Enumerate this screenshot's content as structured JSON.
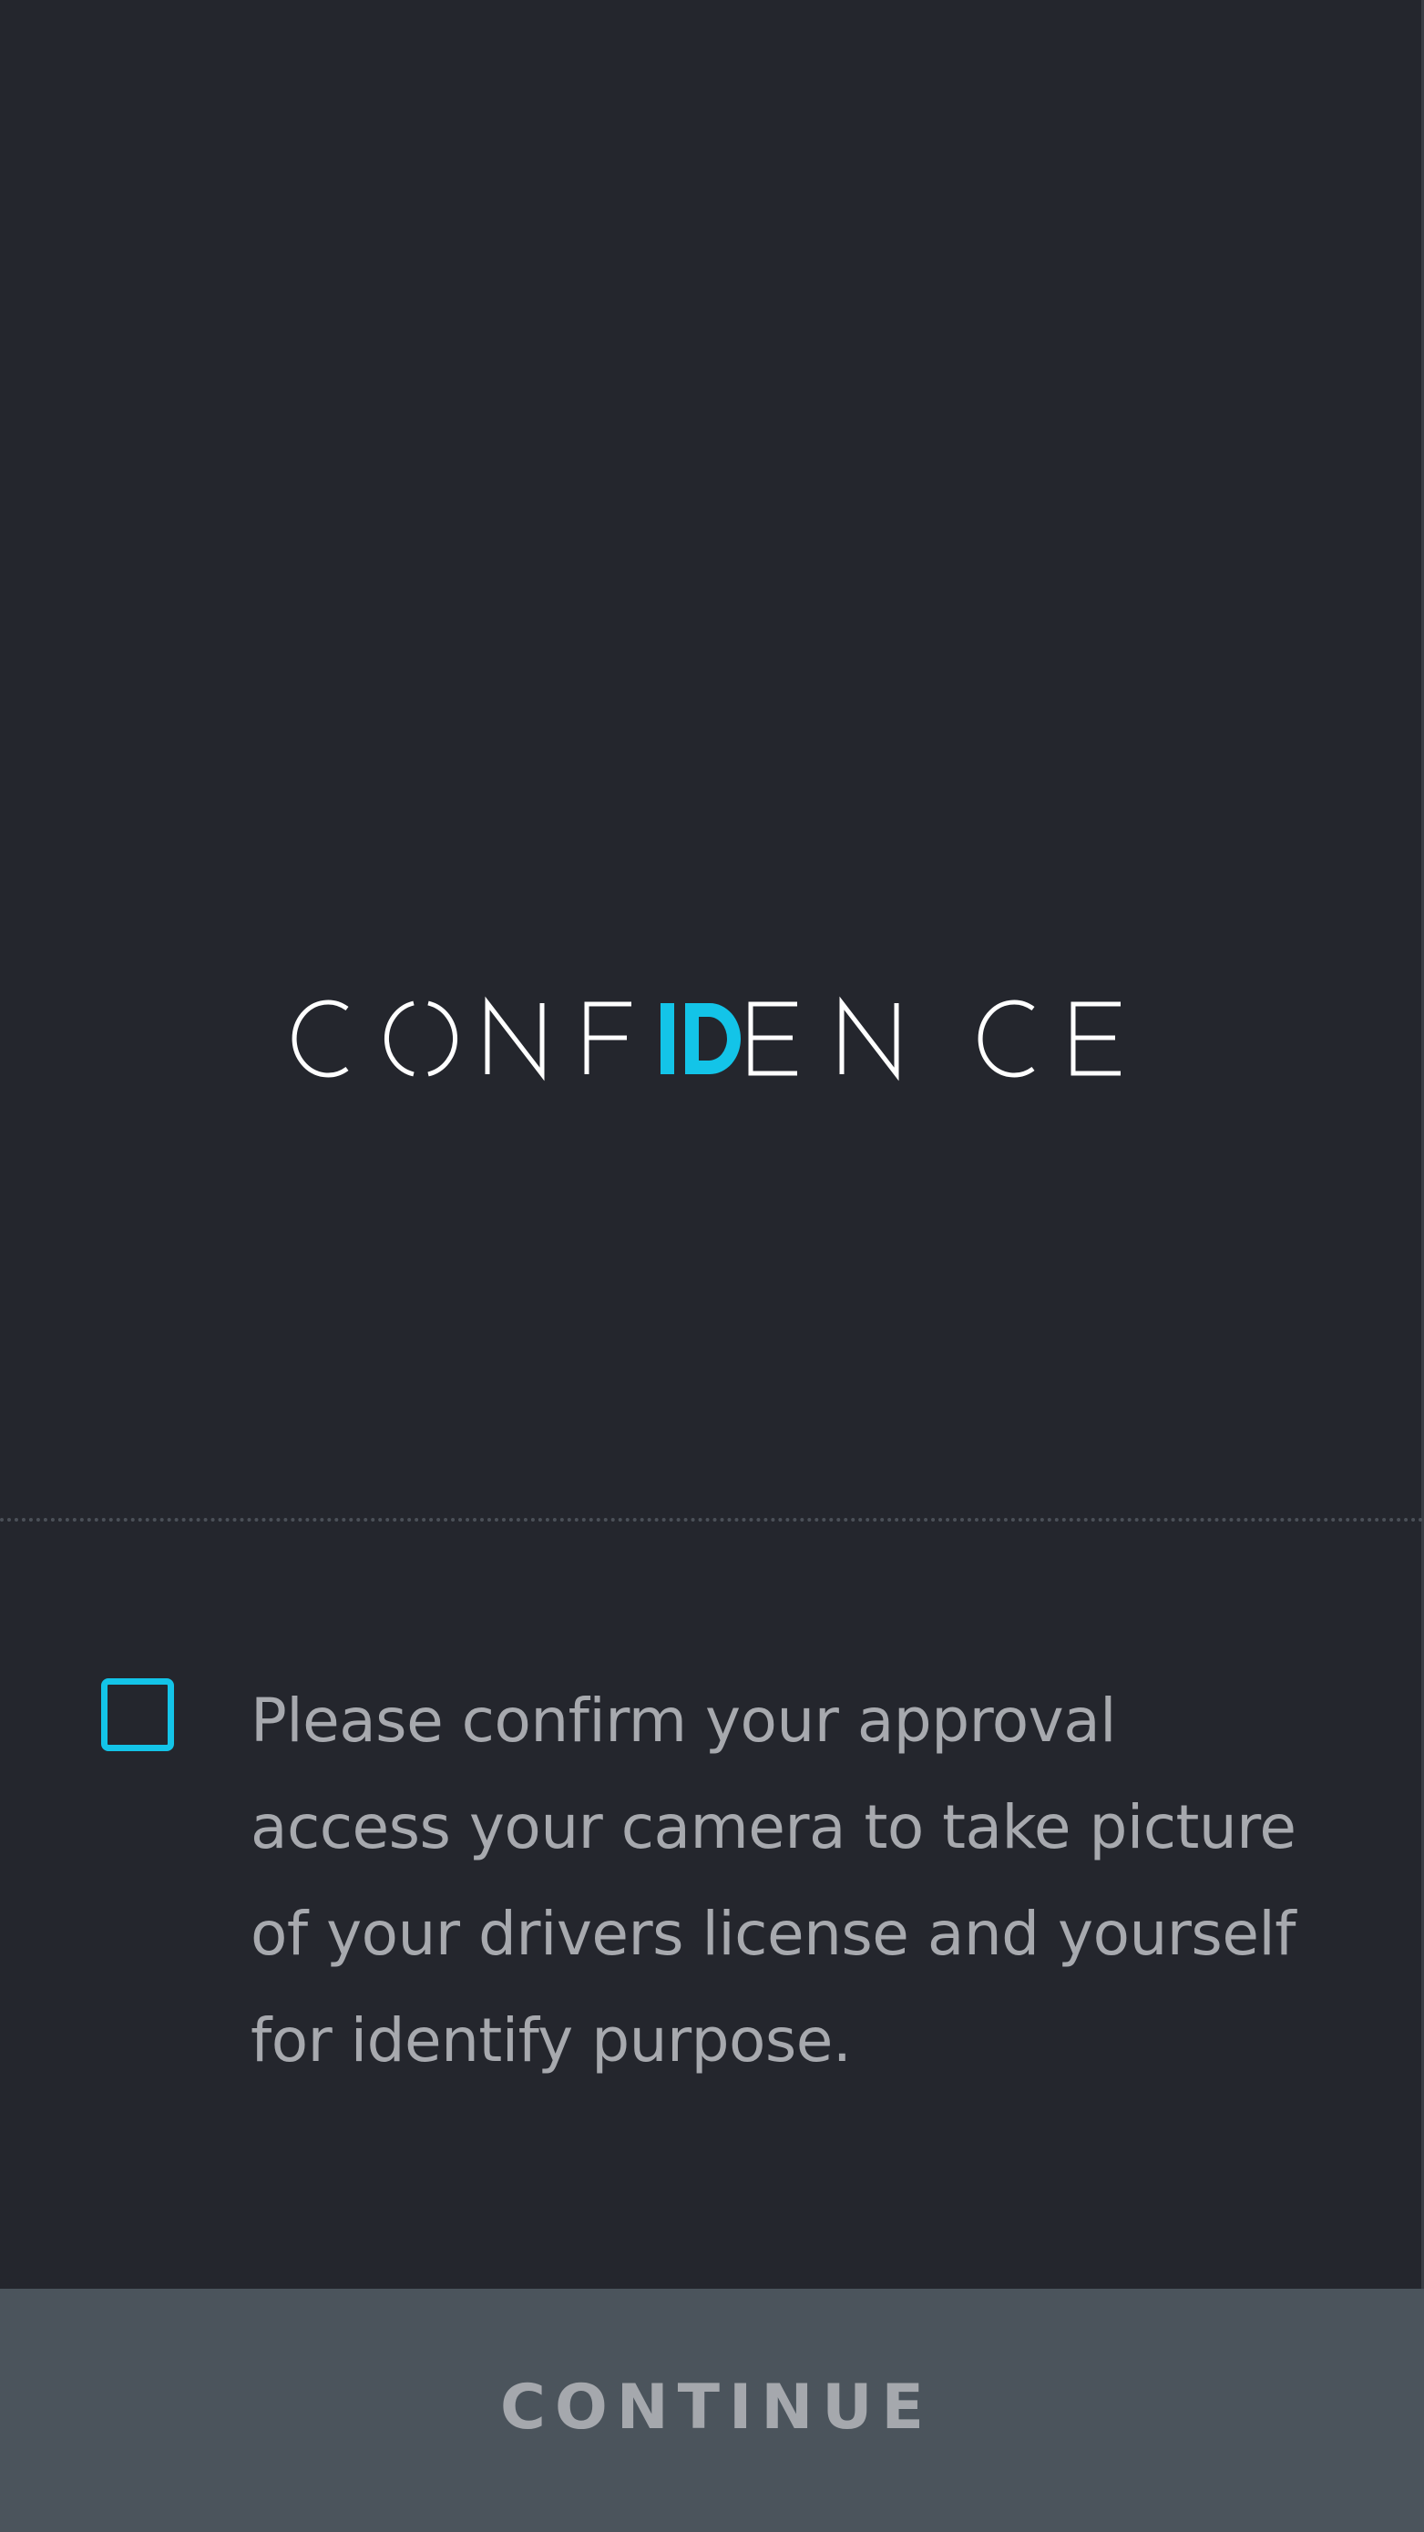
{
  "brand": {
    "logo_text": "CONFIDENCE",
    "logo_highlight": "ID",
    "logo_color": "#ffffff",
    "highlight_color": "#13c4e8"
  },
  "consent": {
    "checked": false,
    "text": "Please confirm your approval access your camera to take picture of your drivers license and yourself for identify purpose."
  },
  "footer": {
    "continue_label": "CONTINUE"
  },
  "colors": {
    "background": "#24262d",
    "accent": "#13c4e8",
    "button_background": "#4b545c",
    "text_muted": "#a7a9ae"
  }
}
